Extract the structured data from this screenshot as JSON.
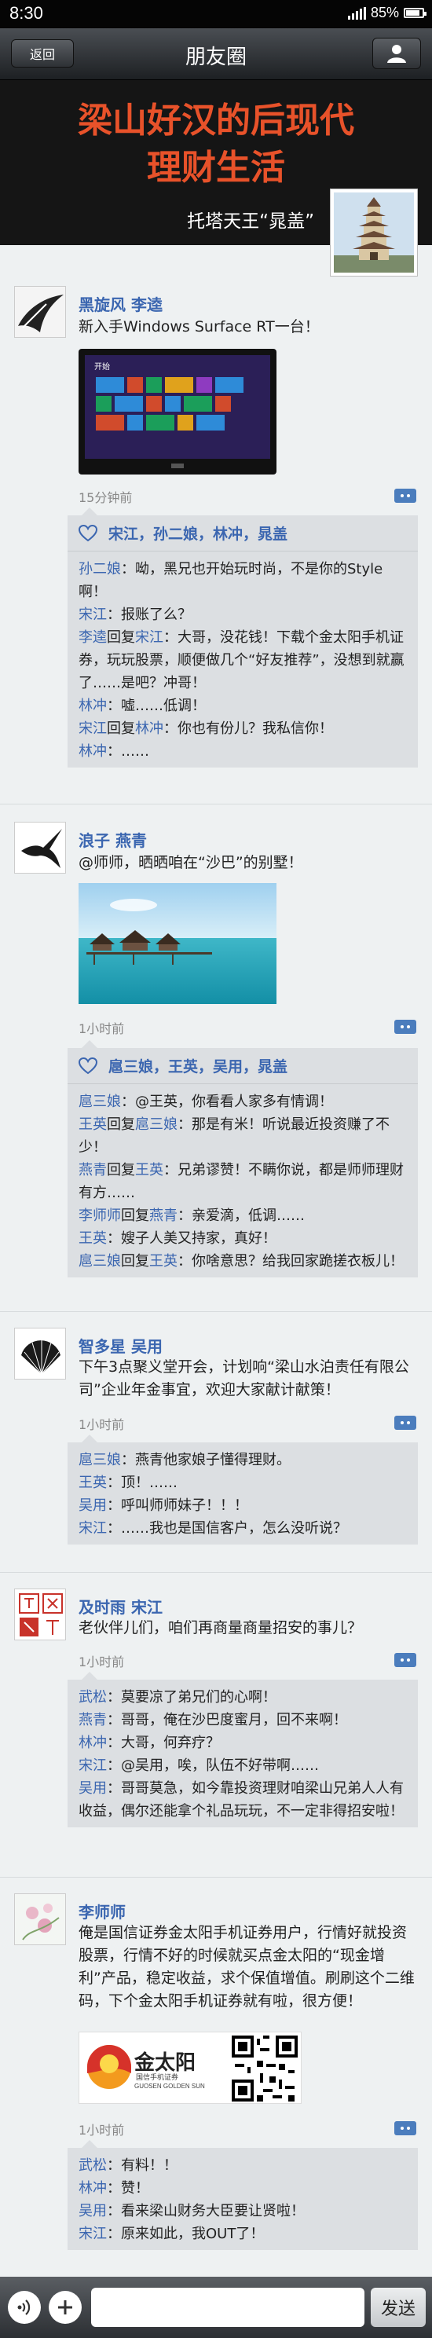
{
  "status": {
    "time": "8:30",
    "battery": "85%",
    "battery_level": 0.85
  },
  "nav": {
    "back_label": "返回",
    "title": "朋友圈"
  },
  "banner": {
    "headline_1": "梁山好汉的后现代",
    "headline_2": "理财生活",
    "byline": "托塔天王“晁盖”"
  },
  "colors": {
    "accent_name": "#3b66b0",
    "title_red": "#e8522a",
    "nav": "#2c2f33"
  },
  "posts": [
    {
      "author": "黑旋风 李逵",
      "text": "新入手Windows Surface RT一台！",
      "time": "15分钟前",
      "likes": "宋江，孙二娘，林冲，晁盖",
      "comments": [
        {
          "name": "孙二娘",
          "text": "：呦，黑兄也开始玩时尚，不是你的Style啊！"
        },
        {
          "name": "宋江",
          "text": "：报账了么？"
        },
        {
          "name": "李逵",
          "reply": "宋江",
          "text": "：大哥，没花钱！下载个金太阳手机证券，玩玩股票，顺便做几个“好友推荐”，没想到就赢了……是吧？冲哥！"
        },
        {
          "name": "林冲",
          "text": "：嘘……低调！"
        },
        {
          "name": "宋江",
          "reply": "林冲",
          "text": "：你也有份儿？我私信你！"
        },
        {
          "name": "林冲",
          "text": "：……"
        }
      ]
    },
    {
      "author": "浪子 燕青",
      "text": "@师师，晒晒咱在“沙巴”的别墅！",
      "time": "1小时前",
      "likes": "扈三娘，王英，吴用，晁盖",
      "comments": [
        {
          "name": "扈三娘",
          "text": "：@王英，你看看人家多有情调！"
        },
        {
          "name": "王英",
          "reply": "扈三娘",
          "text": "：那是有米！听说最近投资赚了不少！"
        },
        {
          "name": "燕青",
          "reply": "王英",
          "text": "：兄弟谬赞！不瞒你说，都是师师理财有方……"
        },
        {
          "name": "李师师",
          "reply": "燕青",
          "text": "：亲爱滴，低调……"
        },
        {
          "name": "王英",
          "text": "：嫂子人美又持家，真好！"
        },
        {
          "name": "扈三娘",
          "reply": "王英",
          "text": "：你啥意思？给我回家跪搓衣板儿！"
        }
      ]
    },
    {
      "author": "智多星 吴用",
      "text": "下午3点聚义堂开会，计划响“梁山水泊责任有限公司”企业年金事宜，欢迎大家献计献策！",
      "time": "1小时前",
      "comments": [
        {
          "name": "扈三娘",
          "text": "：燕青他家娘子懂得理财。"
        },
        {
          "name": "王英",
          "text": "：顶！……"
        },
        {
          "name": "吴用",
          "text": "：呼叫师师妹子！！！"
        },
        {
          "name": "宋江",
          "text": "：……我也是国信客户，怎么没听说？"
        }
      ]
    },
    {
      "author": "及时雨 宋江",
      "text": "老伙伴儿们，咱们再商量商量招安的事儿？",
      "time": "1小时前",
      "comments": [
        {
          "name": "武松",
          "text": "：莫要凉了弟兄们的心啊！"
        },
        {
          "name": "燕青",
          "text": "：哥哥，俺在沙巴度蜜月，回不来啊！"
        },
        {
          "name": "林冲",
          "text": "：大哥，何弃疗？"
        },
        {
          "name": "宋江",
          "text": "：@吴用，唉，队伍不好带啊……"
        },
        {
          "name": "吴用",
          "text": "：哥哥莫急，如今靠投资理财咱梁山兄弟人人有收益，偶尔还能拿个礼品玩玩，不一定非得招安啦！"
        }
      ]
    },
    {
      "author": "李师师",
      "text": "俺是国信证券金太阳手机证券用户，行情好就投资股票，行情不好的时候就买点金太阳的“现金增利”产品，稳定收益，求个保值增值。刷刷这个二维码，下个金太阳手机证券就有啦，很方便！",
      "time": "1小时前",
      "logo_text": "金太阳",
      "logo_sub": "国信手机证券",
      "logo_en": "GUOSEN GOLDEN SUN",
      "comments": [
        {
          "name": "武松",
          "text": "：有料！！"
        },
        {
          "name": "林冲",
          "text": "：赞！"
        },
        {
          "name": "吴用",
          "text": "：看来梁山财务大臣要让贤啦！"
        },
        {
          "name": "宋江",
          "text": "：原来如此，我OUT了！"
        }
      ]
    }
  ],
  "composer": {
    "send_label": "发送"
  }
}
